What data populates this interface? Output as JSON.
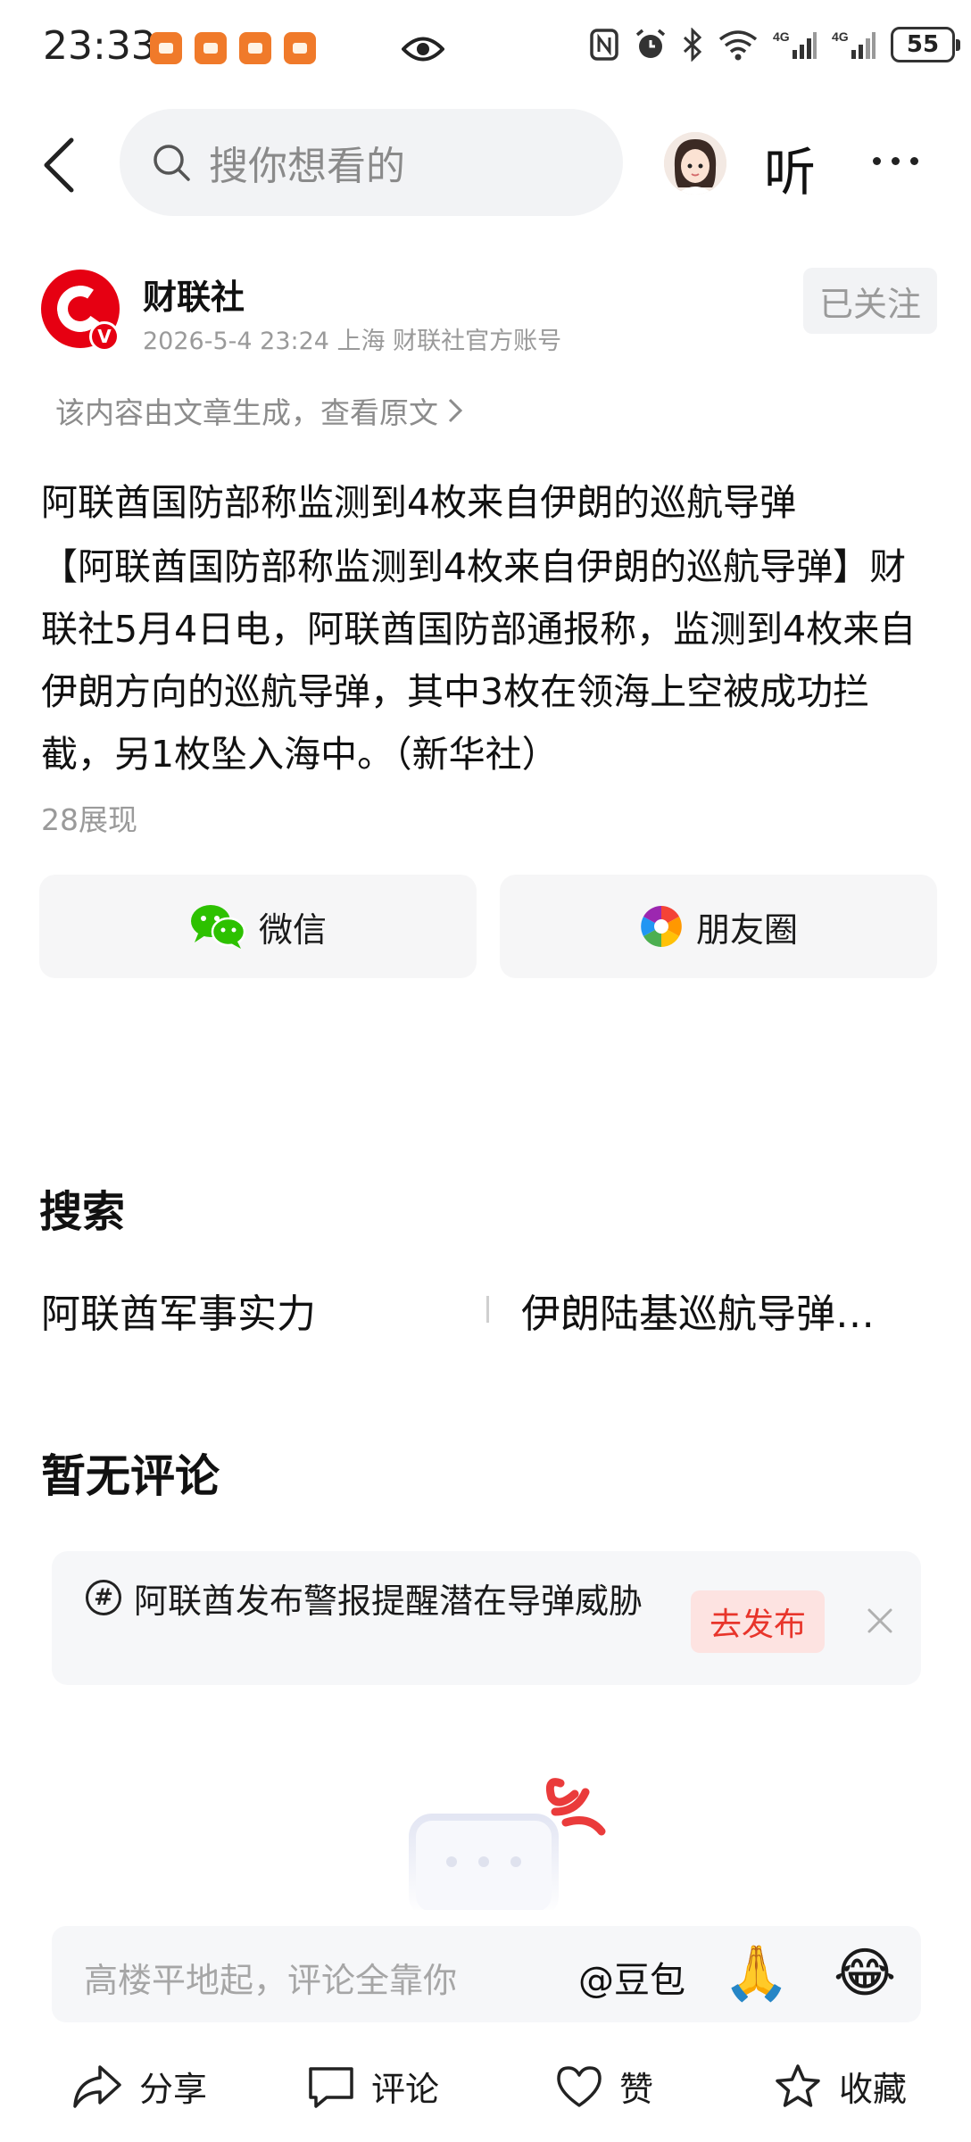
{
  "status_bar": {
    "time": "23:33",
    "battery": "55",
    "network": "4G"
  },
  "nav": {
    "search_placeholder": "搜你想看的",
    "listen_label": "听"
  },
  "author": {
    "name": "财联社",
    "meta": "2026-5-4 23:24 上海 财联社官方账号",
    "follow_label": "已关注",
    "verified_badge": "V"
  },
  "generated_note": "该内容由文章生成，查看原文",
  "article": {
    "title": "阿联酋国防部称监测到4枚来自伊朗的巡航导弹",
    "body": "【阿联酋国防部称监测到4枚来自伊朗的巡航导弹】财联社5月4日电，阿联酋国防部通报称，监测到4枚来自伊朗方向的巡航导弹，其中3枚在领海上空被成功拦截，另1枚坠入海中。（新华社）",
    "views": "28展现"
  },
  "share": {
    "wechat_label": "微信",
    "moments_label": "朋友圈"
  },
  "search_section": {
    "heading": "搜索",
    "items": [
      "阿联酋军事实力",
      "伊朗陆基巡航导弹…"
    ]
  },
  "comments": {
    "empty_label": "暂无评论",
    "topic_text": "阿联酋发布警报提醒潜在导弹威胁",
    "topic_icon": "#",
    "publish_label": "去发布"
  },
  "comment_bar": {
    "placeholder": "高楼平地起，评论全靠你",
    "mention": "@豆包",
    "emoji_1": "🙏",
    "emoji_2": "😂"
  },
  "toolbar": {
    "share_label": "分享",
    "comment_label": "评论",
    "like_label": "赞",
    "favorite_label": "收藏"
  },
  "colors": {
    "accent_red": "#e60012",
    "publish_red": "#e8352b",
    "wechat_green": "#2dc100"
  }
}
